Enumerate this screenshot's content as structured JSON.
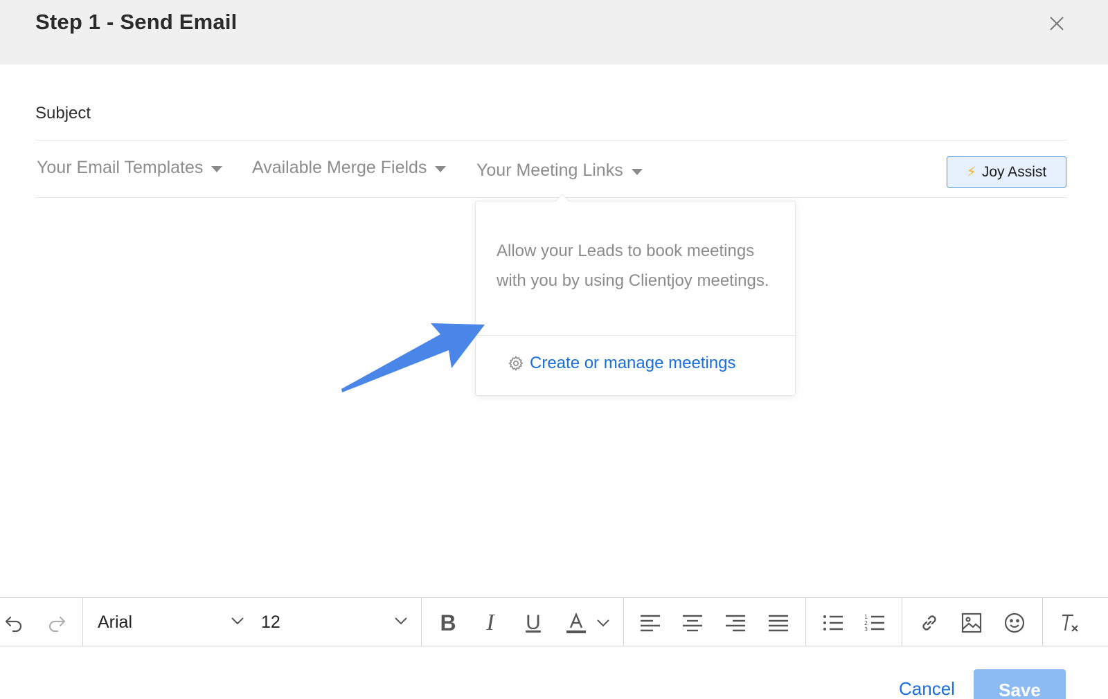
{
  "dialog": {
    "title": "Step 1 - Send Email",
    "close_icon": "close-icon"
  },
  "subject": {
    "label": "Subject"
  },
  "merge_bar": {
    "email_templates": "Your Email Templates",
    "merge_fields": "Available Merge Fields",
    "meeting_links": "Your Meeting Links",
    "joy_assist": "Joy Assist",
    "joy_icon": "lightning-icon"
  },
  "meeting_popover": {
    "description": "Allow your Leads to book meetings with you by using Clientjoy meetings.",
    "link_label": "Create or manage meetings",
    "link_icon": "gear-icon",
    "link_color": "#1a6fe0"
  },
  "annotation": {
    "arrow_color": "#4a86e8"
  },
  "editor_toolbar": {
    "font_family": "Arial",
    "font_size": "12",
    "icons": [
      "undo-icon",
      "redo-icon",
      "bold-icon",
      "italic-icon",
      "underline-icon",
      "font-color-icon",
      "align-left-icon",
      "align-center-icon",
      "align-right-icon",
      "align-justify-icon",
      "bulleted-list-icon",
      "numbered-list-icon",
      "link-icon",
      "image-icon",
      "emoji-icon",
      "clear-formatting-icon"
    ]
  },
  "footer": {
    "cancel_label": "Cancel",
    "save_label": "Save",
    "save_color": "#8cbaf3"
  }
}
